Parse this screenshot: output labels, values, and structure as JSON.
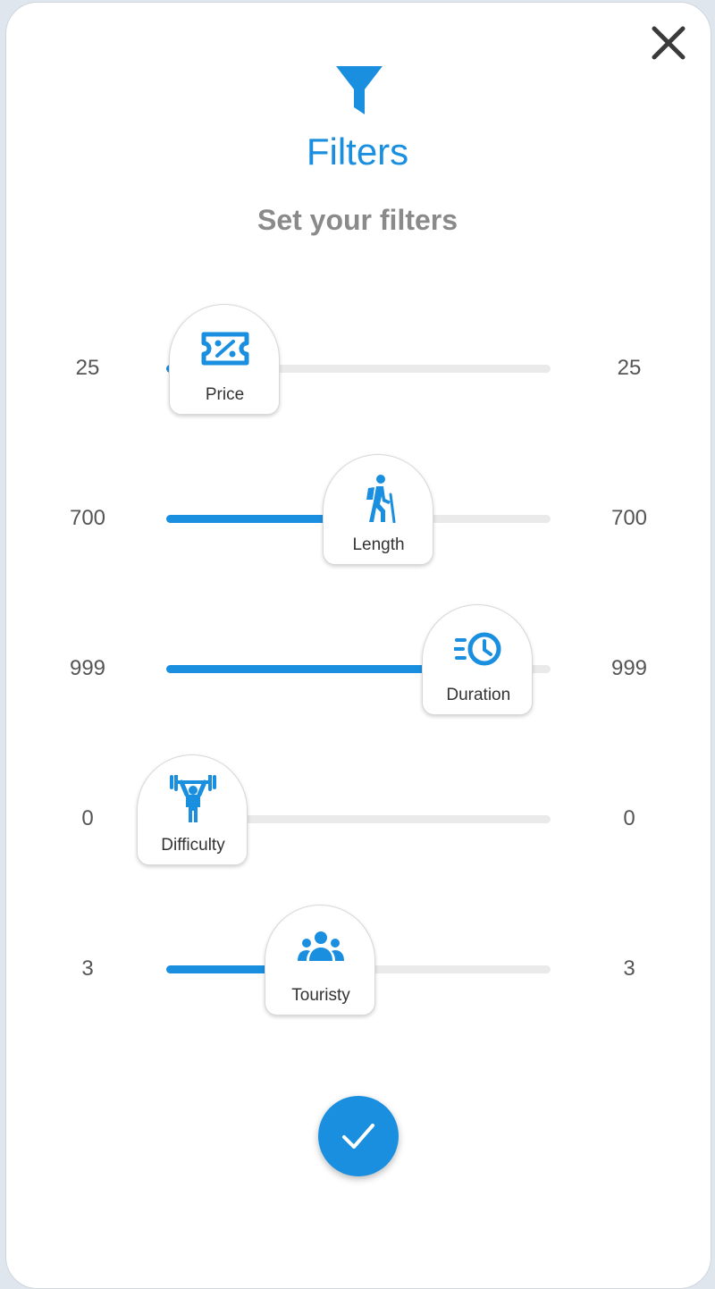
{
  "header": {
    "icon": "filter-icon",
    "title": "Filters",
    "subtitle": "Set your filters",
    "close_icon": "close-icon"
  },
  "colors": {
    "accent": "#1a8fe0",
    "track": "#eaeaea",
    "subtitle": "#8a8a8a"
  },
  "filters": [
    {
      "key": "price",
      "label": "Price",
      "icon": "ticket-percent-icon",
      "min_label": "25",
      "max_label": "25",
      "fill_fraction": 0.15
    },
    {
      "key": "length",
      "label": "Length",
      "icon": "hiker-icon",
      "min_label": "700",
      "max_label": "700",
      "fill_fraction": 0.55
    },
    {
      "key": "duration",
      "label": "Duration",
      "icon": "clock-fast-icon",
      "min_label": "999",
      "max_label": "999",
      "fill_fraction": 0.81
    },
    {
      "key": "difficulty",
      "label": "Difficulty",
      "icon": "weightlifter-icon",
      "min_label": "0",
      "max_label": "0",
      "fill_fraction": 0.0
    },
    {
      "key": "touristy",
      "label": "Touristy",
      "icon": "group-icon",
      "min_label": "3",
      "max_label": "3",
      "fill_fraction": 0.4
    }
  ],
  "confirm_icon": "check-icon"
}
